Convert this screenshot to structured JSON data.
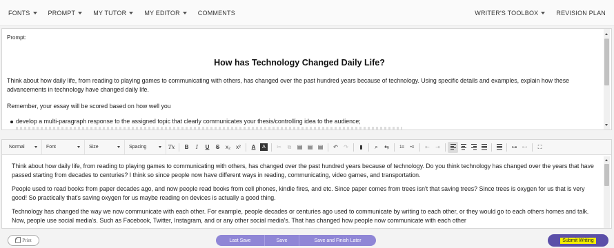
{
  "menu": {
    "left": [
      {
        "label": "FONTS",
        "dropdown": true
      },
      {
        "label": "PROMPT",
        "dropdown": true
      },
      {
        "label": "MY TUTOR",
        "dropdown": true
      },
      {
        "label": "MY EDITOR",
        "dropdown": true
      },
      {
        "label": "COMMENTS",
        "dropdown": false
      }
    ],
    "right": [
      {
        "label": "WRITER'S TOOLBOX",
        "dropdown": true
      },
      {
        "label": "REVISION PLAN",
        "dropdown": false
      }
    ]
  },
  "prompt": {
    "label": "Prompt:",
    "title": "How has Technology Changed Daily Life?",
    "paragraph1": "Think about how daily life, from reading to playing games to communicating with others, has changed over the past hundred years because of technology. Using specific details and examples, explain how these advancements in technology have changed daily life.",
    "paragraph2": "Remember, your essay will be scored based on how well you",
    "bullet1": "develop a multi-paragraph response to the assigned topic that clearly communicates your thesis/controlling idea to the audience;"
  },
  "toolbar": {
    "style_select": "Normal",
    "font_select": "Font",
    "size_select": "Size",
    "spacing_select": "Spacing",
    "clear_format": "Tx",
    "bold": "B",
    "italic": "I",
    "underline": "U",
    "strikethrough": "S",
    "subscript": "x₂",
    "superscript": "x²",
    "text_color": "A",
    "bg_color": "A",
    "cut": "✂",
    "copy": "⧉",
    "paste": "▤",
    "paste_text": "▤",
    "paste_word": "▤",
    "undo": "↶",
    "redo": "↷",
    "comment": "▮",
    "find": "⌕",
    "replace": "⇆",
    "ordered_list": "1≡",
    "unordered_list": "•≡",
    "outdent": "⇤",
    "indent": "⇥",
    "link": "⊶",
    "unlink": "⊷",
    "maximize": "⛶"
  },
  "editor": {
    "paragraphs": [
      "Think about how daily life, from reading to playing games to communicating with others, has changed over the past hundred years because of technology. Do you think technology has changed over the years that have passed starting from decades to centuries? I  think so since people now have different ways in reading, communicating, video games, and transportation.",
      "People used to read books from paper decades ago, and now people read books from cell phones, kindle fires, and etc. Since paper comes from trees isn't that saving trees? Since trees is oxygen for us that is very good! So practically that's saving oxygen for us maybe reading on devices is actually a good thing.",
      "Technology has changed the way we now communicate with each other. For example, people decades or centuries ago used to communicate by writing to each other, or they would go to each others homes and talk. Now, people use social media's. Such as Facebook, Twitter, Instagram, and or any other social media's. That has changed how people now communicate with each other"
    ]
  },
  "footer": {
    "print_label": "Print",
    "last_save_label": "Last Save",
    "save_label": "Save",
    "save_finish_label": "Save and Finish Later",
    "submit_label": "Submit Writing"
  },
  "colors": {
    "button_group": "#8f86d6",
    "submit_bg": "#5b4fa8",
    "submit_highlight": "#f5f000"
  }
}
